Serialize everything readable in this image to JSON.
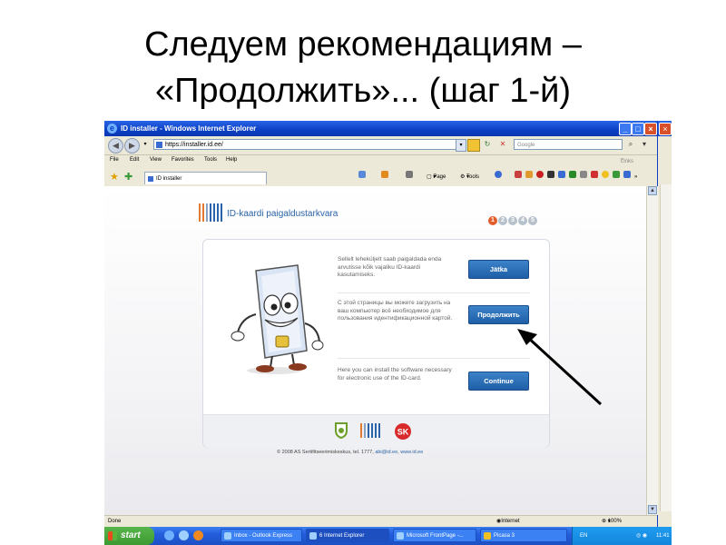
{
  "slide": {
    "title_line1": "Следуем рекомендациям –",
    "title_line2": "«Продолжить»... (шаг 1-й)"
  },
  "browser": {
    "window_title": "ID installer - Windows Internet Explorer",
    "address": "https://installer.id.ee/",
    "search_placeholder": "Google",
    "menu": [
      "File",
      "Edit",
      "View",
      "Favorites",
      "Tools",
      "Help"
    ],
    "links_label": "Links",
    "tab_label": "ID installer",
    "cmd_page": "Page",
    "cmd_tools": "Tools",
    "status_left": "Done",
    "status_zone": "Internet",
    "zoom": "100%"
  },
  "page": {
    "site_title": "ID-kaardi paigaldustarkvara",
    "steps": [
      "1",
      "2",
      "3",
      "4",
      "5"
    ],
    "active_step": 1,
    "rows": [
      {
        "text": "Sellelt leheküljelt saab paigaldada enda arvutisse kõik vajaliku ID-kaardi kasutamiseks.",
        "button": "Jätka"
      },
      {
        "text": "С этой страницы вы можете загрузить на ваш компьютер всё необходимое для пользования идентификационной картой.",
        "button": "Продолжить"
      },
      {
        "text": "Here you can install the software necessary for electronic use of the ID-card.",
        "button": "Continue"
      }
    ],
    "footer_logo_text": "SK",
    "copyright_prefix": "© 2008 AS Sertifitseerimiskeskus, tel. 1777,",
    "copyright_email": "abi@id.ee",
    "copyright_sep": ",",
    "copyright_site": "www.id.ee"
  },
  "taskbar": {
    "start": "start",
    "items": [
      "Inbox - Outlook Express",
      "6 Internet Explorer",
      "Microsoft FrontPage -...",
      "Picasa 3"
    ],
    "lang": "EN",
    "clock": "11:41"
  },
  "colors": {
    "accent_blue": "#1f5fa8",
    "step_active": "#e35d2a",
    "xp_blue": "#245edc",
    "start_green": "#3d9a33"
  }
}
